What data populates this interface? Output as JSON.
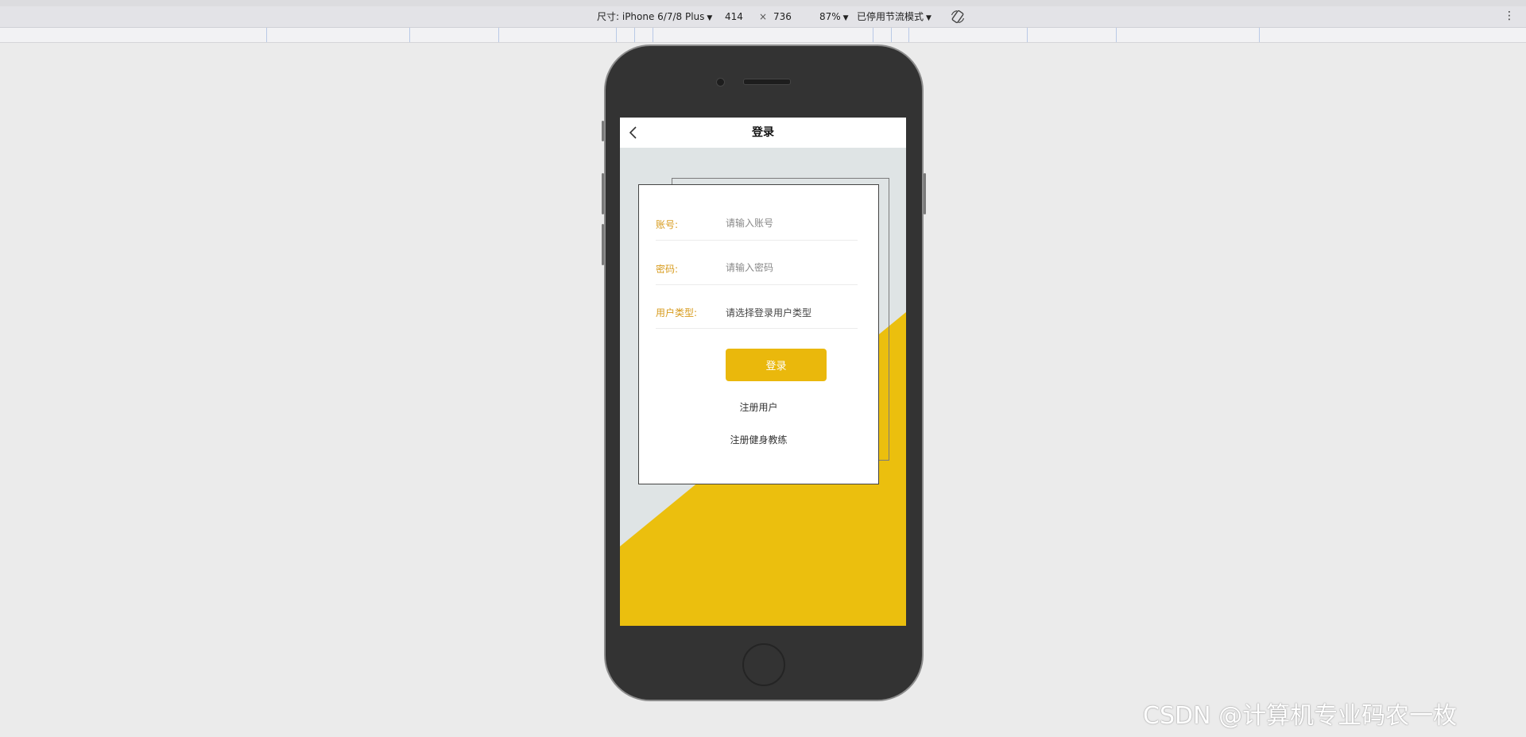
{
  "devtools": {
    "size_label": "尺寸: iPhone 6/7/8 Plus",
    "width": "414",
    "times": "×",
    "height": "736",
    "zoom": "87%",
    "throttle": "已停用节流模式",
    "caret": "▼",
    "more": "⋮"
  },
  "app": {
    "nav_title": "登录",
    "fields": {
      "account": {
        "label": "账号:",
        "placeholder": "请输入账号"
      },
      "password": {
        "label": "密码:",
        "placeholder": "请输入密码"
      },
      "user_type": {
        "label": "用户类型:",
        "placeholder": "请选择登录用户类型"
      }
    },
    "login_button": "登录",
    "register_user": "注册用户",
    "register_coach": "注册健身教练"
  },
  "colors": {
    "accent": "#eab80c",
    "label": "#d79b1d"
  },
  "watermark": "CSDN @计算机专业码农一枚"
}
